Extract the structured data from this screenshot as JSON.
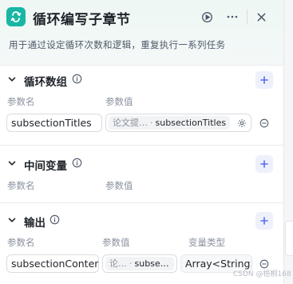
{
  "node": {
    "title": "循环编写子章节",
    "description": "用于通过设定循环次数和逻辑，重复执行一系列任务",
    "accent_color": "#19b6a4"
  },
  "header_actions": [
    "run-icon",
    "more-icon",
    "close-icon"
  ],
  "sections": {
    "loop_array": {
      "title": "循环数组",
      "col_name": "参数名",
      "col_value": "参数值",
      "rows": [
        {
          "name": "subsectionTitles",
          "ref_source": "论文提…",
          "ref_var": "subsectionTitles"
        }
      ]
    },
    "intermediate": {
      "title": "中间变量",
      "col_name": "参数名",
      "col_value": "参数值"
    },
    "output": {
      "title": "输出",
      "col_name": "参数名",
      "col_value": "参数值",
      "col_type": "变量类型",
      "rows": [
        {
          "name": "subsectionContent",
          "ref_source": "论…",
          "ref_var": "subse…",
          "type": "Array<String>"
        }
      ]
    }
  },
  "watermark": "CSDN @梧桐168",
  "colors": {
    "add_button_bg": "#eef0fb",
    "add_icon": "#5b6cf0",
    "border": "#d9dce1"
  }
}
